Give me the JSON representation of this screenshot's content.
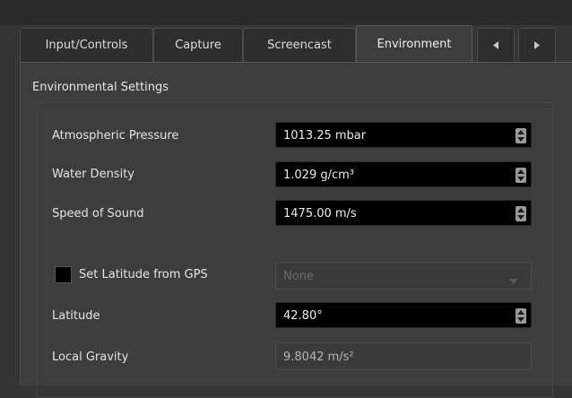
{
  "tabs": [
    {
      "label": "Input/Controls"
    },
    {
      "label": "Capture"
    },
    {
      "label": "Screencast"
    },
    {
      "label": "Environment"
    }
  ],
  "active_tab": "Environment",
  "panel": {
    "title": "Environmental Settings",
    "fields": {
      "atmospheric_pressure": {
        "label": "Atmospheric Pressure",
        "value": "1013.25 mbar"
      },
      "water_density": {
        "label": "Water Density",
        "value": "1.029 g/cm³"
      },
      "speed_of_sound": {
        "label": "Speed of Sound",
        "value": "1475.00 m/s"
      },
      "gps": {
        "label": "Set Latitude from GPS",
        "checked": false,
        "selected": "None"
      },
      "latitude": {
        "label": "Latitude",
        "value": "42.80°"
      },
      "local_gravity": {
        "label": "Local Gravity",
        "value": "9.8042 m/s²"
      }
    }
  },
  "icons": {
    "scroll_left": "triangle-left-icon",
    "scroll_right": "triangle-right-icon",
    "spin": "spin-arrows-icon",
    "dropdown": "chevron-down-icon"
  },
  "colors": {
    "background": "#353535",
    "panel": "#3d3d3d",
    "field": "#000000",
    "text": "#e4e4e4"
  }
}
